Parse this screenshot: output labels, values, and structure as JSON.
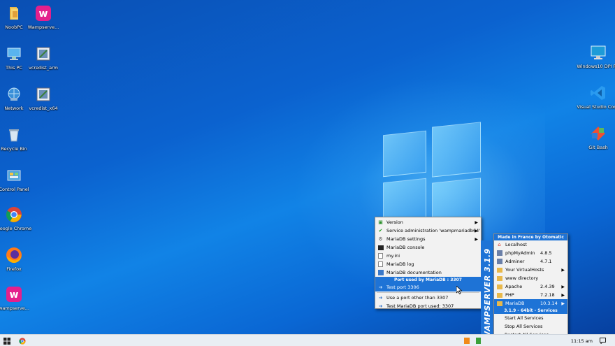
{
  "desktop": {
    "icons_left": [
      {
        "label": "NoobPC",
        "icon": "folder-icon"
      },
      {
        "label": "Wampserve...",
        "icon": "wampserver-icon"
      },
      {
        "label": "This PC",
        "icon": "computer-icon"
      },
      {
        "label": "vcredist_arm",
        "icon": "installer-icon"
      },
      {
        "label": "Network",
        "icon": "network-icon"
      },
      {
        "label": "vcredist_x64",
        "icon": "installer-icon"
      },
      {
        "label": "Recycle Bin",
        "icon": "recycle-bin-icon"
      },
      {
        "label": "Control Panel",
        "icon": "control-panel-icon"
      },
      {
        "label": "Google Chrome",
        "icon": "chrome-icon"
      },
      {
        "label": "Firefox",
        "icon": "firefox-icon"
      },
      {
        "label": "wampserve...",
        "icon": "wampserver-icon"
      }
    ],
    "icons_right": [
      {
        "label": "Windows10 DPI Fix",
        "icon": "monitor-icon"
      },
      {
        "label": "Visual Studio Code",
        "icon": "vscode-icon"
      },
      {
        "label": "Git Bash",
        "icon": "git-bash-icon"
      }
    ]
  },
  "mariadb_menu": {
    "items": [
      {
        "label": "Version",
        "icon": "version-icon",
        "submenu": true
      },
      {
        "label": "Service administration 'wampmariadb64'",
        "icon": "checkmark-icon",
        "submenu": true
      },
      {
        "label": "MariaDB settings",
        "icon": "settings-icon",
        "submenu": true
      },
      {
        "label": "MariaDB console",
        "icon": "console-icon"
      },
      {
        "label": "my.ini",
        "icon": "document-icon"
      },
      {
        "label": "MariaDB log",
        "icon": "document-icon"
      },
      {
        "label": "MariaDB documentation",
        "icon": "help-doc-icon"
      }
    ],
    "port_header": "Port used by MariaDB : 3307",
    "port_items": [
      {
        "label": "Test port 3306",
        "icon": "arrow-icon",
        "highlighted": true
      },
      {
        "label": "Use a port other than 3307",
        "icon": "arrow-icon"
      },
      {
        "label": "Test MariaDB port used: 3307",
        "icon": "arrow-icon"
      }
    ]
  },
  "wamp_menu": {
    "header": "Made in France by Otomatic",
    "band_text": "WAMPSERVER 3.1.9",
    "items": [
      {
        "label": "Localhost",
        "icon": "home-icon"
      },
      {
        "label": "phpMyAdmin",
        "icon": "folder-icon",
        "version": "4.8.5"
      },
      {
        "label": "Adminer",
        "icon": "folder-icon",
        "version": "4.7.1"
      },
      {
        "label": "Your VirtualHosts",
        "icon": "folder-icon",
        "submenu": true
      },
      {
        "label": "www directory",
        "icon": "folder-icon"
      },
      {
        "label": "Apache",
        "icon": "folder-icon",
        "version": "2.4.39",
        "submenu": true
      },
      {
        "label": "PHP",
        "icon": "folder-icon",
        "version": "7.2.18",
        "submenu": true
      },
      {
        "label": "MariaDB",
        "icon": "folder-icon",
        "version": "10.3.14",
        "submenu": true,
        "highlighted": true
      }
    ],
    "services_header": "3.1.9 - 64bit - Services",
    "service_items": [
      "Start All Services",
      "Stop All Services",
      "Restart All Services"
    ]
  },
  "taskbar": {
    "start_icon": "windows-start-icon",
    "pinned": [
      "chrome-icon"
    ],
    "tray": [
      "notification-tray-icon",
      "wampserver-tray-icon"
    ],
    "clock": "11:15 am",
    "action_center_icon": "action-center-icon"
  },
  "colors": {
    "menu_highlight": "#1e73d6",
    "desktop_blue": "#0b62cf"
  }
}
